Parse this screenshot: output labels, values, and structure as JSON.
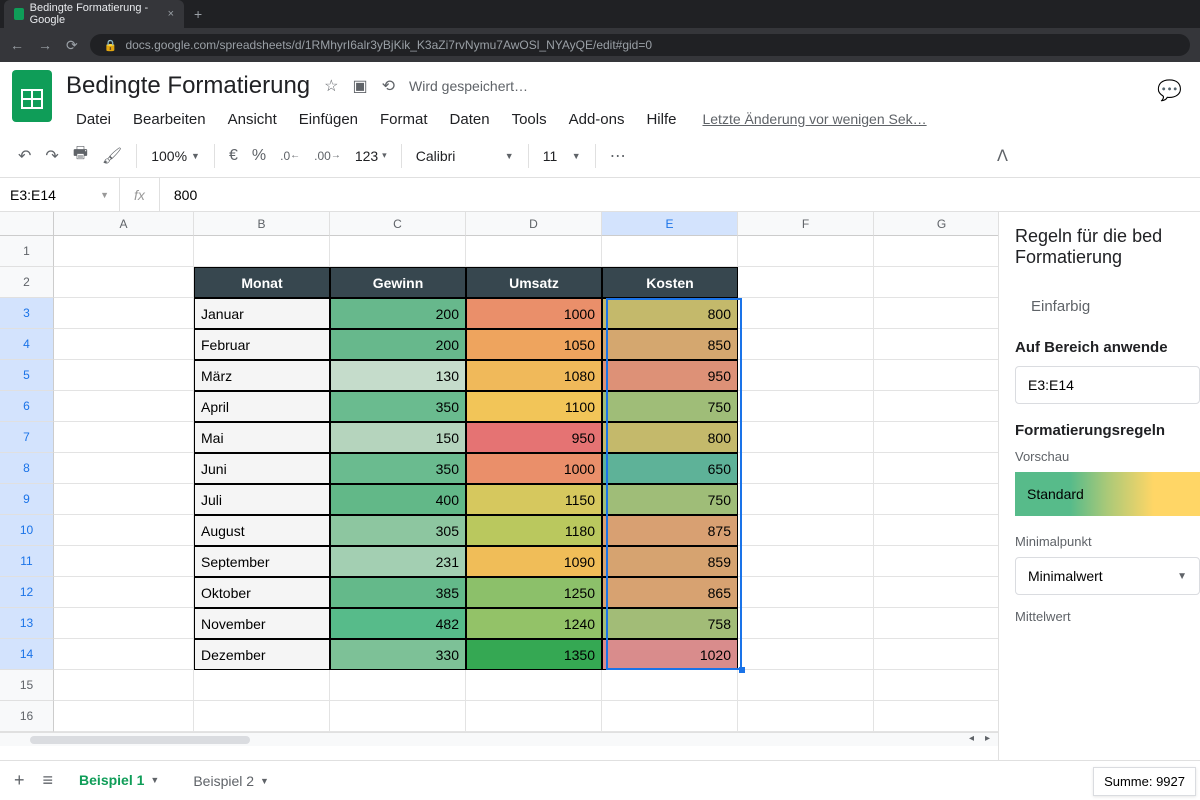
{
  "browser": {
    "tab_title": "Bedingte Formatierung - Google",
    "url": "docs.google.com/spreadsheets/d/1RMhyrI6alr3yBjKik_K3aZi7rvNymu7AwOSl_NYAyQE/edit#gid=0"
  },
  "header": {
    "doc_title": "Bedingte Formatierung",
    "saving": "Wird gespeichert…",
    "menu": [
      "Datei",
      "Bearbeiten",
      "Ansicht",
      "Einfügen",
      "Format",
      "Daten",
      "Tools",
      "Add-ons",
      "Hilfe"
    ],
    "last_edit": "Letzte Änderung vor wenigen Sek…"
  },
  "toolbar": {
    "zoom": "100%",
    "currency": "€",
    "percent": "%",
    "dec_less": ".0",
    "dec_more": ".00",
    "numfmt": "123",
    "font": "Calibri",
    "font_size": "11"
  },
  "formula_bar": {
    "name_box": "E3:E14",
    "fx": "fx",
    "value": "800"
  },
  "columns": [
    "A",
    "B",
    "C",
    "D",
    "E",
    "F",
    "G"
  ],
  "table": {
    "headers": [
      "Monat",
      "Gewinn",
      "Umsatz",
      "Kosten"
    ],
    "rows": [
      {
        "m": "Januar",
        "g": 200,
        "u": 1000,
        "k": 800,
        "gc": "#67b88c",
        "uc": "#ea8f6a",
        "kc": "#c4b96b"
      },
      {
        "m": "Februar",
        "g": 200,
        "u": 1050,
        "k": 850,
        "gc": "#67b88c",
        "uc": "#eea45e",
        "kc": "#d4a76f"
      },
      {
        "m": "März",
        "g": 130,
        "u": 1080,
        "k": 950,
        "gc": "#c5dccb",
        "uc": "#f0b95a",
        "kc": "#dd9177"
      },
      {
        "m": "April",
        "g": 350,
        "u": 1100,
        "k": 750,
        "gc": "#6abb8f",
        "uc": "#f2c558",
        "kc": "#9fbd78"
      },
      {
        "m": "Mai",
        "g": 150,
        "u": 950,
        "k": 800,
        "gc": "#b5d4bd",
        "uc": "#e57373",
        "kc": "#c4b96b"
      },
      {
        "m": "Juni",
        "g": 350,
        "u": 1000,
        "k": 650,
        "gc": "#6abb8f",
        "uc": "#ea8f6a",
        "kc": "#5eb298"
      },
      {
        "m": "Juli",
        "g": 400,
        "u": 1150,
        "k": 750,
        "gc": "#62b888",
        "uc": "#d6c85e",
        "kc": "#9fbd78"
      },
      {
        "m": "August",
        "g": 305,
        "u": 1180,
        "k": 875,
        "gc": "#8dc6a0",
        "uc": "#bac85e",
        "kc": "#d8a072"
      },
      {
        "m": "September",
        "g": 231,
        "u": 1090,
        "k": 859,
        "gc": "#a3cfb2",
        "uc": "#f0bd58",
        "kc": "#d6a370"
      },
      {
        "m": "Oktober",
        "g": 385,
        "u": 1250,
        "k": 865,
        "gc": "#64b98a",
        "uc": "#8cc06a",
        "kc": "#d7a271"
      },
      {
        "m": "November",
        "g": 482,
        "u": 1240,
        "k": 758,
        "gc": "#57bb8a",
        "uc": "#93c268",
        "kc": "#a2bc77"
      },
      {
        "m": "Dezember",
        "g": 330,
        "u": 1350,
        "k": 1020,
        "gc": "#7dc197",
        "uc": "#35a853",
        "kc": "#d98c8c"
      }
    ]
  },
  "side": {
    "title1": "Regeln für die bed",
    "title2": "Formatierung",
    "tab_single": "Einfarbig",
    "apply_label": "Auf Bereich anwende",
    "range": "E3:E14",
    "rules_label": "Formatierungsregeln",
    "preview_label": "Vorschau",
    "preview_text": "Standard",
    "min_label": "Minimalpunkt",
    "min_value": "Minimalwert",
    "mid_label": "Mittelwert"
  },
  "sheets": {
    "active": "Beispiel 1",
    "other": "Beispiel 2"
  },
  "status": "Summe: 9927"
}
